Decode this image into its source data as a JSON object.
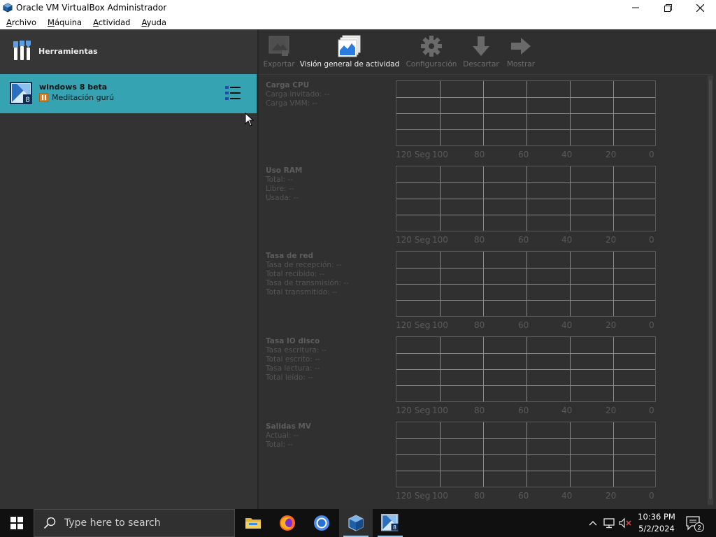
{
  "window": {
    "title": "Oracle VM VirtualBox Administrador",
    "controls": {
      "minimize": "—",
      "maximize": "☐",
      "close": "✕"
    }
  },
  "menu": [
    "Archivo",
    "Máquina",
    "Actividad",
    "Ayuda"
  ],
  "sidebar": {
    "tools_label": "Herramientas",
    "vm": {
      "name": "windows 8 beta",
      "state": "Meditación gurú",
      "os_badge": "8"
    }
  },
  "toolbar": [
    {
      "label": "Exportar",
      "icon": "export-icon",
      "enabled": false
    },
    {
      "label": "Visión general de actividad",
      "icon": "activity-overview-icon",
      "enabled": true
    },
    {
      "label": "Configuración",
      "icon": "gear-icon",
      "enabled": false
    },
    {
      "label": "Descartar",
      "icon": "discard-arrow-icon",
      "enabled": false
    },
    {
      "label": "Mostrar",
      "icon": "show-arrow-icon",
      "enabled": false
    }
  ],
  "metrics": [
    {
      "title": "Carga CPU",
      "lines": [
        "Carga invitado: --",
        "Carga VMM: --"
      ]
    },
    {
      "title": "Uso RAM",
      "lines": [
        "Total: --",
        "Libre: --",
        "Usada: --"
      ]
    },
    {
      "title": "Tasa de red",
      "lines": [
        "Tasa de recepción: --",
        "Total recibido: --",
        "Tasa de transmisión: --",
        "Total transmitido: --"
      ]
    },
    {
      "title": "Tasa IO disco",
      "lines": [
        "Tasa escritura: --",
        "Total escrito: --",
        "Tasa lectura: --",
        "Total leído: --"
      ]
    },
    {
      "title": "Salidas MV",
      "lines": [
        "Actual: --",
        "Total: --"
      ]
    }
  ],
  "graph_ticks": [
    "120 Seg",
    "100",
    "80",
    "60",
    "40",
    "20",
    "0"
  ],
  "taskbar": {
    "search_placeholder": "Type here to search",
    "apps": [
      "file-explorer-icon",
      "firefox-icon",
      "chrome-icon",
      "virtualbox-icon",
      "windows8-vm-icon"
    ],
    "time": "10:36 PM",
    "date": "5/2/2024",
    "notification_count": "2"
  }
}
